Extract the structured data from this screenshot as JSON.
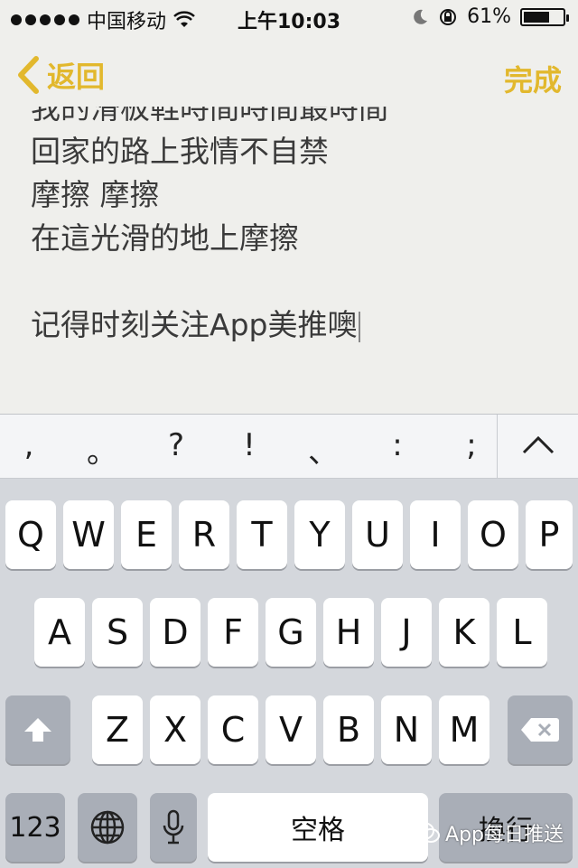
{
  "status": {
    "carrier": "中国移动",
    "time": "上午10:03",
    "battery": "61%",
    "battery_level": 0.61
  },
  "nav": {
    "back_label": "返回",
    "done_label": "完成",
    "accent_color": "#e2b82d"
  },
  "note": {
    "partial_line": "我的滑板鞋時間時間最時間",
    "lines": [
      "回家的路上我情不自禁",
      "摩擦 摩擦",
      "在這光滑的地上摩擦"
    ],
    "last_line": "记得时刻关注App美推噢"
  },
  "keyboard": {
    "punct": [
      ",",
      "。",
      "?",
      "!",
      "、",
      ":",
      ";"
    ],
    "row1": [
      "Q",
      "W",
      "E",
      "R",
      "T",
      "Y",
      "U",
      "I",
      "O",
      "P"
    ],
    "row2": [
      "A",
      "S",
      "D",
      "F",
      "G",
      "H",
      "J",
      "K",
      "L"
    ],
    "row3": [
      "Z",
      "X",
      "C",
      "V",
      "B",
      "N",
      "M"
    ],
    "numbers_label": "123",
    "space_label": "空格",
    "return_label": "換行"
  },
  "watermark": "App每日推送"
}
